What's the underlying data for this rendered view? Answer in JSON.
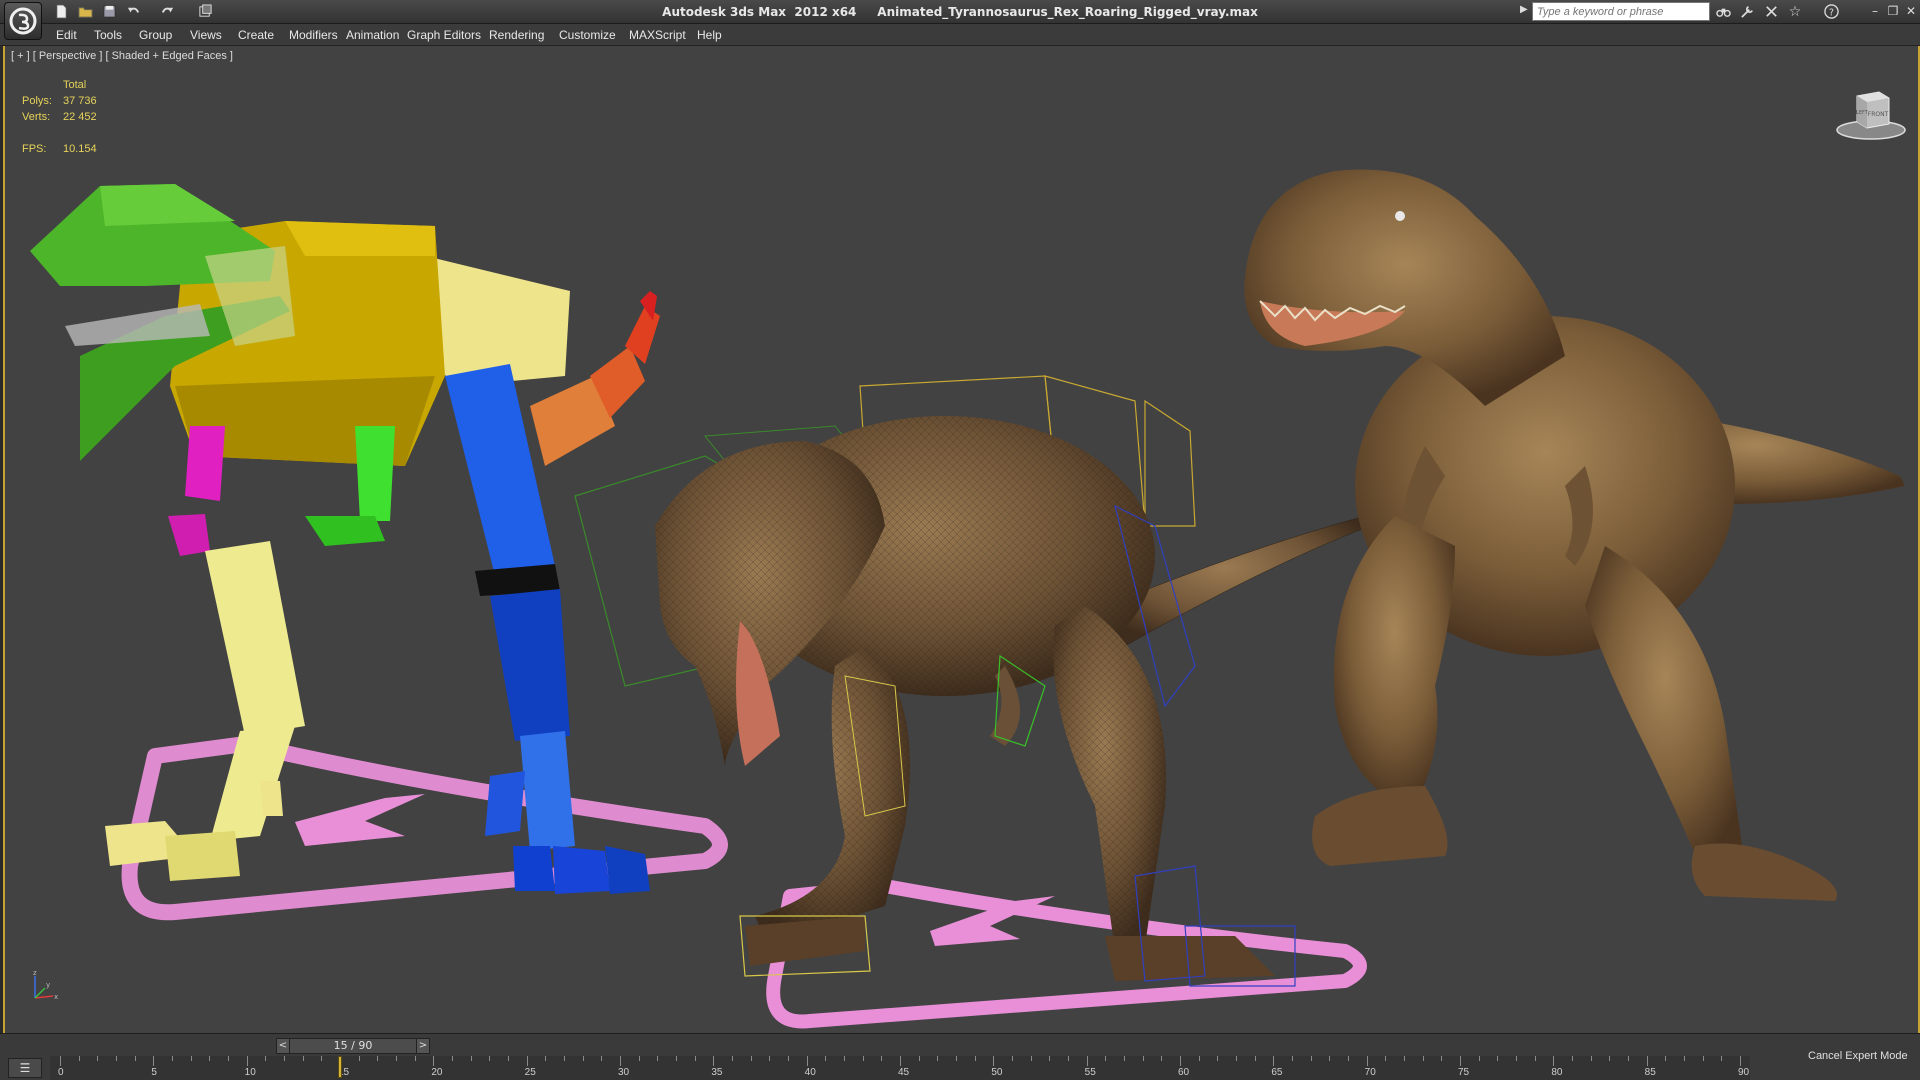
{
  "titlebar": {
    "app_name": "Autodesk 3ds Max  2012 x64",
    "file_name": "Animated_Tyrannosaurus_Rex_Roaring_Rigged_vray.max",
    "search_placeholder": "Type a keyword or phrase"
  },
  "quick_access": [
    "new-icon",
    "open-icon",
    "save-icon",
    "undo-icon",
    "redo-icon",
    "project-icon"
  ],
  "menu": {
    "items": [
      "Edit",
      "Tools",
      "Group",
      "Views",
      "Create",
      "Modifiers",
      "Animation",
      "Graph Editors",
      "Rendering",
      "Customize",
      "MAXScript",
      "Help"
    ]
  },
  "viewport": {
    "label": "[ + ] [ Perspective ] [ Shaded + Edged Faces ]",
    "stats": {
      "header": "Total",
      "polys_label": "Polys:",
      "polys_value": "37 736",
      "verts_label": "Verts:",
      "verts_value": "22 452",
      "fps_label": "FPS:",
      "fps_value": "10.154"
    },
    "viewcube": {
      "front": "FRONT",
      "left": "LEFT"
    },
    "axis": {
      "x": "x",
      "y": "y",
      "z": "z"
    }
  },
  "timeline": {
    "slider_label": "15 / 90",
    "prev": "<",
    "next": ">",
    "current_frame": 15,
    "total_frames": 90,
    "tick_labels": [
      "0",
      "5",
      "10",
      "15",
      "20",
      "25",
      "30",
      "35",
      "40",
      "45",
      "50",
      "55",
      "60",
      "65",
      "70",
      "75",
      "80",
      "85",
      "90"
    ]
  },
  "status": {
    "expert_mode": "Cancel Expert Mode"
  },
  "colors": {
    "accent": "#c8a232",
    "stats": "#e6d35a",
    "viewport_bg": "#424242"
  }
}
